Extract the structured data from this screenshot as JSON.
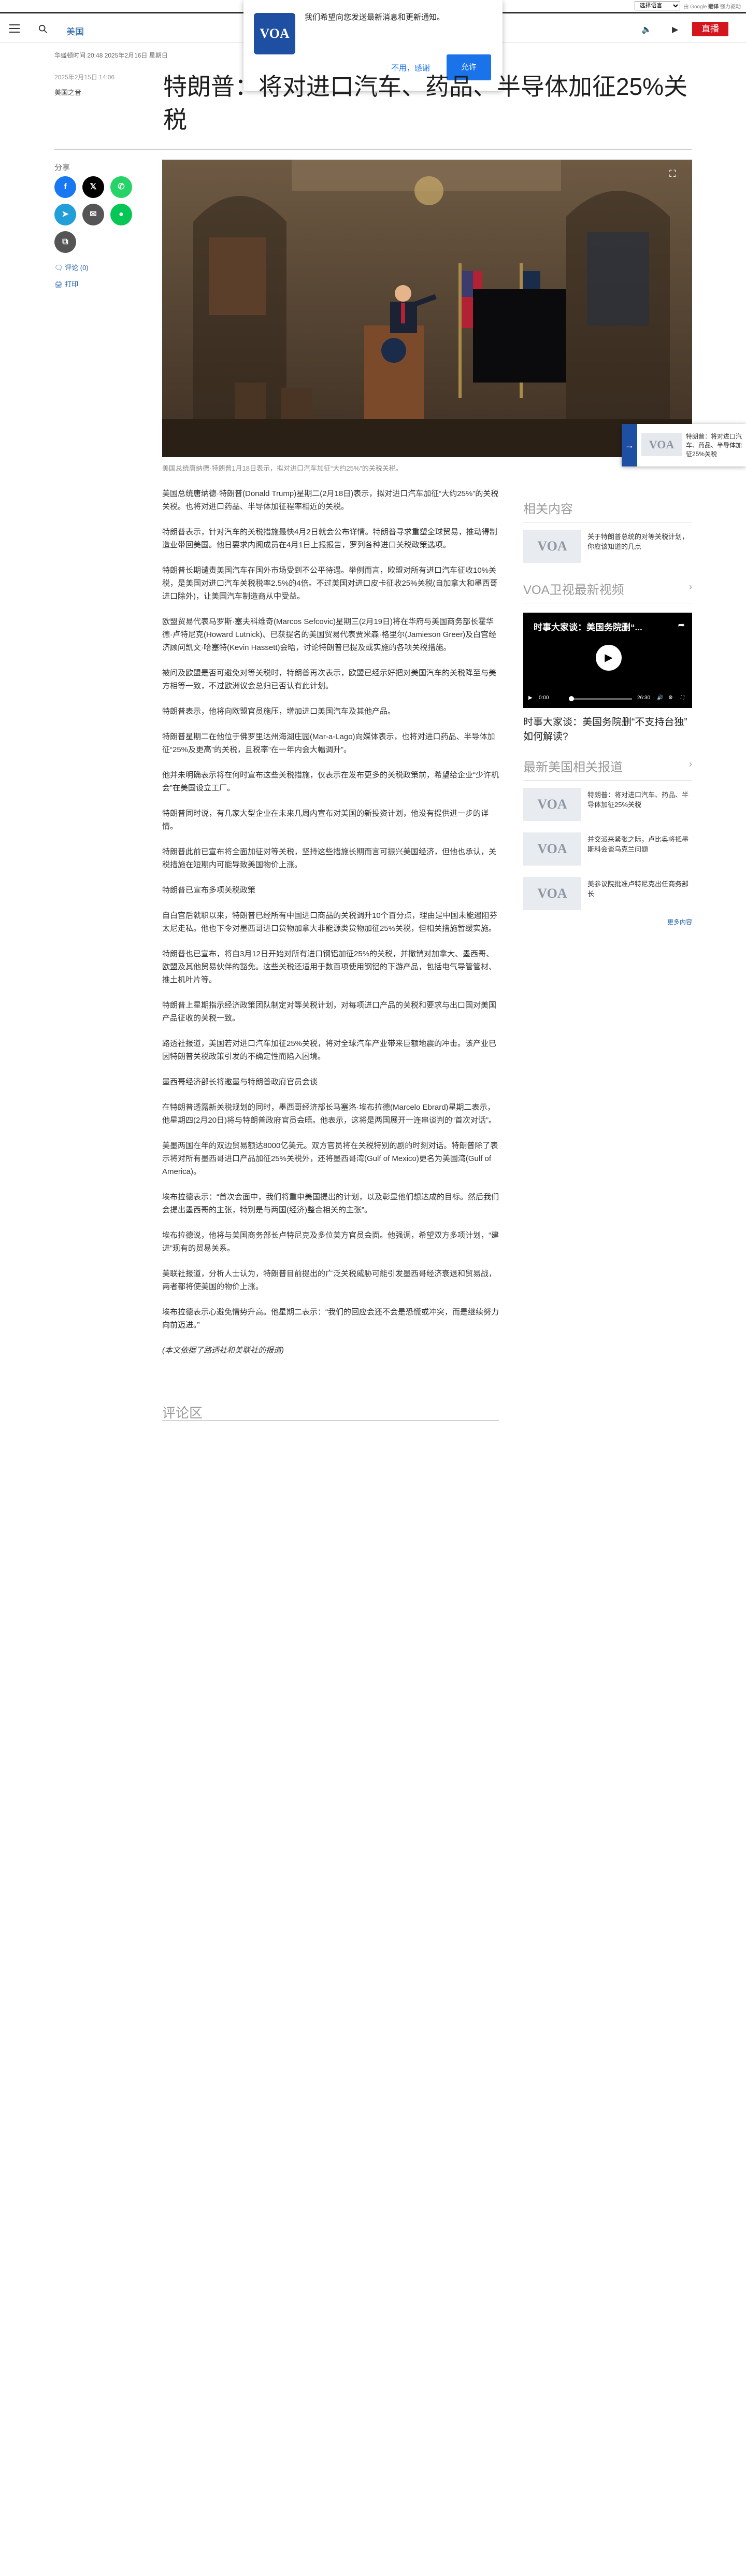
{
  "translate_bar": {
    "select_value": "选择语言",
    "powered_prefix": "由 Google",
    "powered_brand": "翻译",
    "powered_suffix": "强力驱动"
  },
  "header": {
    "section": "美国",
    "live_label": "直播"
  },
  "notification": {
    "logo_text": "VOA",
    "message": "我们希望向您发送最新消息和更新通知。",
    "deny_label": "不用，感谢",
    "allow_label": "允许"
  },
  "article": {
    "dateline": "华盛顿时间 20:48 2025年2月16日 星期日",
    "pubdate": "2025年2月15日 14:06",
    "source": "美国之音",
    "title": "特朗普：将对进口汽车、药品、半导体加征25%关税",
    "hero_alt": "Trump at podium",
    "caption": "美国总统唐纳德·特朗普1月18日表示，拟对进口汽车加征“大约25%”的关税关税。",
    "paragraphs": [
      "美国总统唐纳德·特朗普(Donald Trump)星期二(2月18日)表示，拟对进口汽车加征“大约25%”的关税关税。也将对进口药品、半导体加征程率相近的关税。",
      "特朗普表示，针对汽车的关税措施最快4月2日就会公布详情。特朗普寻求重塑全球贸易，推动得制造业带回美国。他日要求内阁成员在4月1日上报报告，罗列各种进口关税政策选项。",
      "特朗普长期谴责美国汽车在国外市场受到不公平待遇。举例而言，欧盟对所有进口汽车征收10%关税，是美国对进口汽车关税税率2.5%的4倍。不过美国对进口皮卡征收25%关税(自加拿大和墨西哥进口除外)，让美国汽车制造商从中受益。",
      "欧盟贸易代表马罗斯·塞夫科维奇(Marcos Sefcovic)星期三(2月19日)将在华府与美国商务部长霍华德·卢特尼克(Howard Lutnick)、已获提名的美国贸易代表贾米森·格里尔(Jamieson Greer)及白宫经济顾问凯文·哈塞特(Kevin Hassett)会晤，讨论特朗普已提及或实施的各项关税措施。",
      "被问及欧盟是否可避免对等关税时，特朗普再次表示，欧盟已经示好把对美国汽车的关税降至与美方相等一致，不过欧洲议会总归已否认有此计划。",
      "特朗普表示，他将向欧盟官员施压，增加进口美国汽车及其他产品。",
      "特朗普星期二在他位于佛罗里达州海湖庄园(Mar-a-Lago)向媒体表示，也将对进口药品、半导体加征“25%及更高”的关税，且税率“在一年内会大幅调升”。",
      "他并未明确表示将在何时宣布这些关税措施，仅表示在发布更多的关税政策前，希望给企业“少许机会”在美国设立工厂。",
      "特朗普同时说，有几家大型企业在未来几周内宣布对美国的新投资计划，他没有提供进一步的详情。",
      "特朗普此前已宣布将全面加征对等关税，坚持这些措施长期而言可振兴美国经济，但他也承认，关税措施在短期内可能导致美国物价上涨。",
      "特朗普已宣布多项关税政策",
      "自白宫后就职以来，特朗普已经所有中国进口商品的关税调升10个百分点，理由是中国未能遏阻芬太尼走私。他也下令对墨西哥进口货物加拿大非能源类货物加征25%关税，但相关措施暂缓实施。",
      "特朗普也已宣布，将自3月12日开始对所有进口钢铝加征25%的关税，并撤销对加拿大、墨西哥、欧盟及其他贸易伙伴的豁免。这些关税还适用于数百项使用钢铝的下游产品，包括电气导管管材、推土机叶片等。",
      "特朗普上星期指示经济政策团队制定对等关税计划，对每项进口产品的关税和要求与出口国对美国产品征收的关税一致。",
      "路透社报道，美国若对进口汽车加征25%关税，将对全球汽车产业带来巨额地震的冲击。该产业已因特朗普关税政策引发的不确定性而陷入困境。",
      "墨西哥经济部长将邀墨与特朗普政府官员会谈",
      "在特朗普透露新关税规划的同时，墨西哥经济部长马塞洛·埃布拉德(Marcelo Ebrard)星期二表示，他星期四(2月20日)将与特朗普政府官员会晤。他表示，这将是两国展开一连串谈判的“首次对话”。",
      "美墨两国在年的双边贸易额达8000亿美元。双方官员将在关税特别的剧的时刻对话。特朗普除了表示将对所有墨西哥进口产品加征25%关税外，还将墨西哥湾(Gulf of Mexico)更名为美国湾(Gulf of America)。",
      "埃布拉德表示：“首次会面中，我们将重申美国提出的计划，以及彰显他们想达成的目标。然后我们会提出墨西哥的主张，特别是与两国(经济)整合相关的主张”。",
      "埃布拉德说，他将与美国商务部长卢特尼克及多位美方官员会面。他强调，希望双方多项计划，“建进”现有的贸易关系。",
      "美联社报道，分析人士认为，特朗普目前提出的广泛关税威胁可能引发墨西哥经济衰退和贸易战，两者都将使美国的物价上涨。",
      "埃布拉德表示心避免情势升高。他星期二表示：“我们的回应会还不会是恐慌或冲突，而是继续努力向前迈进。”",
      "(本文依据了路透社和美联社的报道)"
    ],
    "comments_title": "评论区"
  },
  "share": {
    "label": "分享",
    "comments_link": "评论 (0)",
    "print_link": "打印"
  },
  "float_card": {
    "text": "特朗普：将对进口汽车、药品、半导体加征25%关税"
  },
  "sidebar": {
    "related_title": "相关内容",
    "related_items": [
      {
        "text": "关于特朗普总统的对等关税计划，你应该知道的几点"
      }
    ],
    "video_section_title": "VOA卫视最新视频",
    "video": {
      "overlay_title": "时事大家谈：美国务院删“...",
      "current_time": "0:00",
      "duration": "26:30",
      "caption": "时事大家谈：美国务院删“不支持台独” 如何解读?"
    },
    "latest_title": "最新美国相关报道",
    "latest_items": [
      {
        "text": "特朗普：将对进口汽车、药品、半导体加征25%关税"
      },
      {
        "text": "并交派来紧张之际，卢比奥将抵墨斯科会谈乌克兰问题"
      },
      {
        "text": "美参议院批准卢特尼克出任商务部长"
      }
    ],
    "more_link": "更多内容"
  }
}
